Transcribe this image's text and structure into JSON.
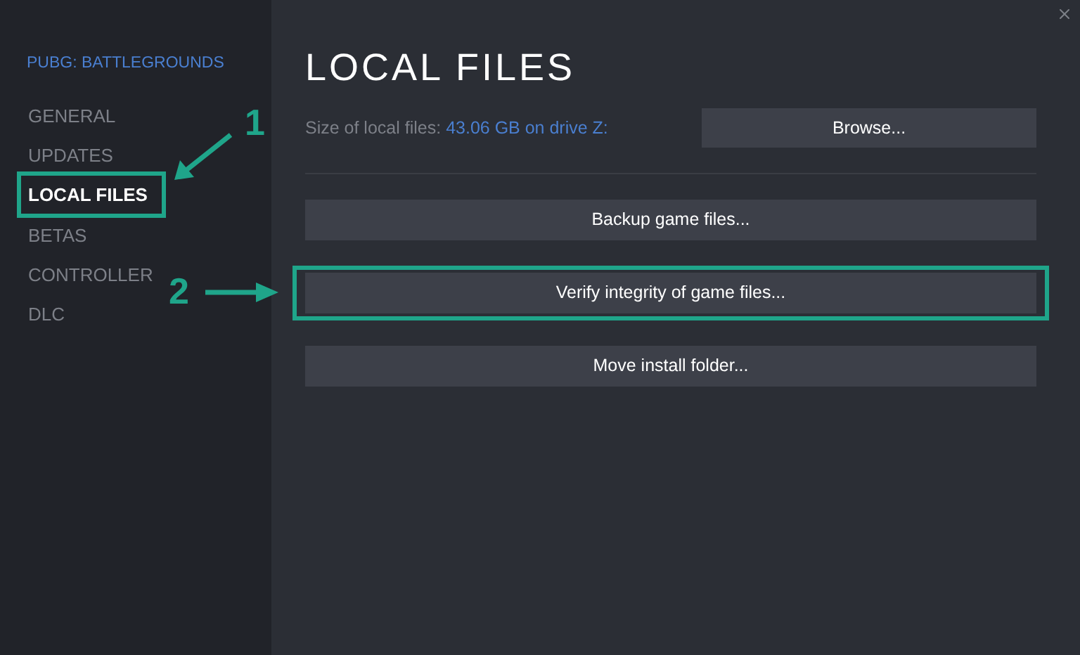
{
  "app": {
    "title": "PUBG: BATTLEGROUNDS"
  },
  "sidebar": {
    "items": [
      {
        "label": "GENERAL",
        "selected": false,
        "highlighted": false
      },
      {
        "label": "UPDATES",
        "selected": false,
        "highlighted": false
      },
      {
        "label": "LOCAL FILES",
        "selected": true,
        "highlighted": true
      },
      {
        "label": "BETAS",
        "selected": false,
        "highlighted": false
      },
      {
        "label": "CONTROLLER",
        "selected": false,
        "highlighted": false
      },
      {
        "label": "DLC",
        "selected": false,
        "highlighted": false
      }
    ]
  },
  "page": {
    "heading": "LOCAL FILES",
    "size_label": "Size of local files:",
    "size_value": "43.06 GB on drive Z:",
    "browse": "Browse...",
    "actions": [
      {
        "label": "Backup game files...",
        "highlighted": false
      },
      {
        "label": "Verify integrity of game files...",
        "highlighted": true
      },
      {
        "label": "Move install folder...",
        "highlighted": false
      }
    ]
  },
  "callouts": [
    {
      "number": "1",
      "kind": "diagonal"
    },
    {
      "number": "2",
      "kind": "horizontal"
    }
  ]
}
